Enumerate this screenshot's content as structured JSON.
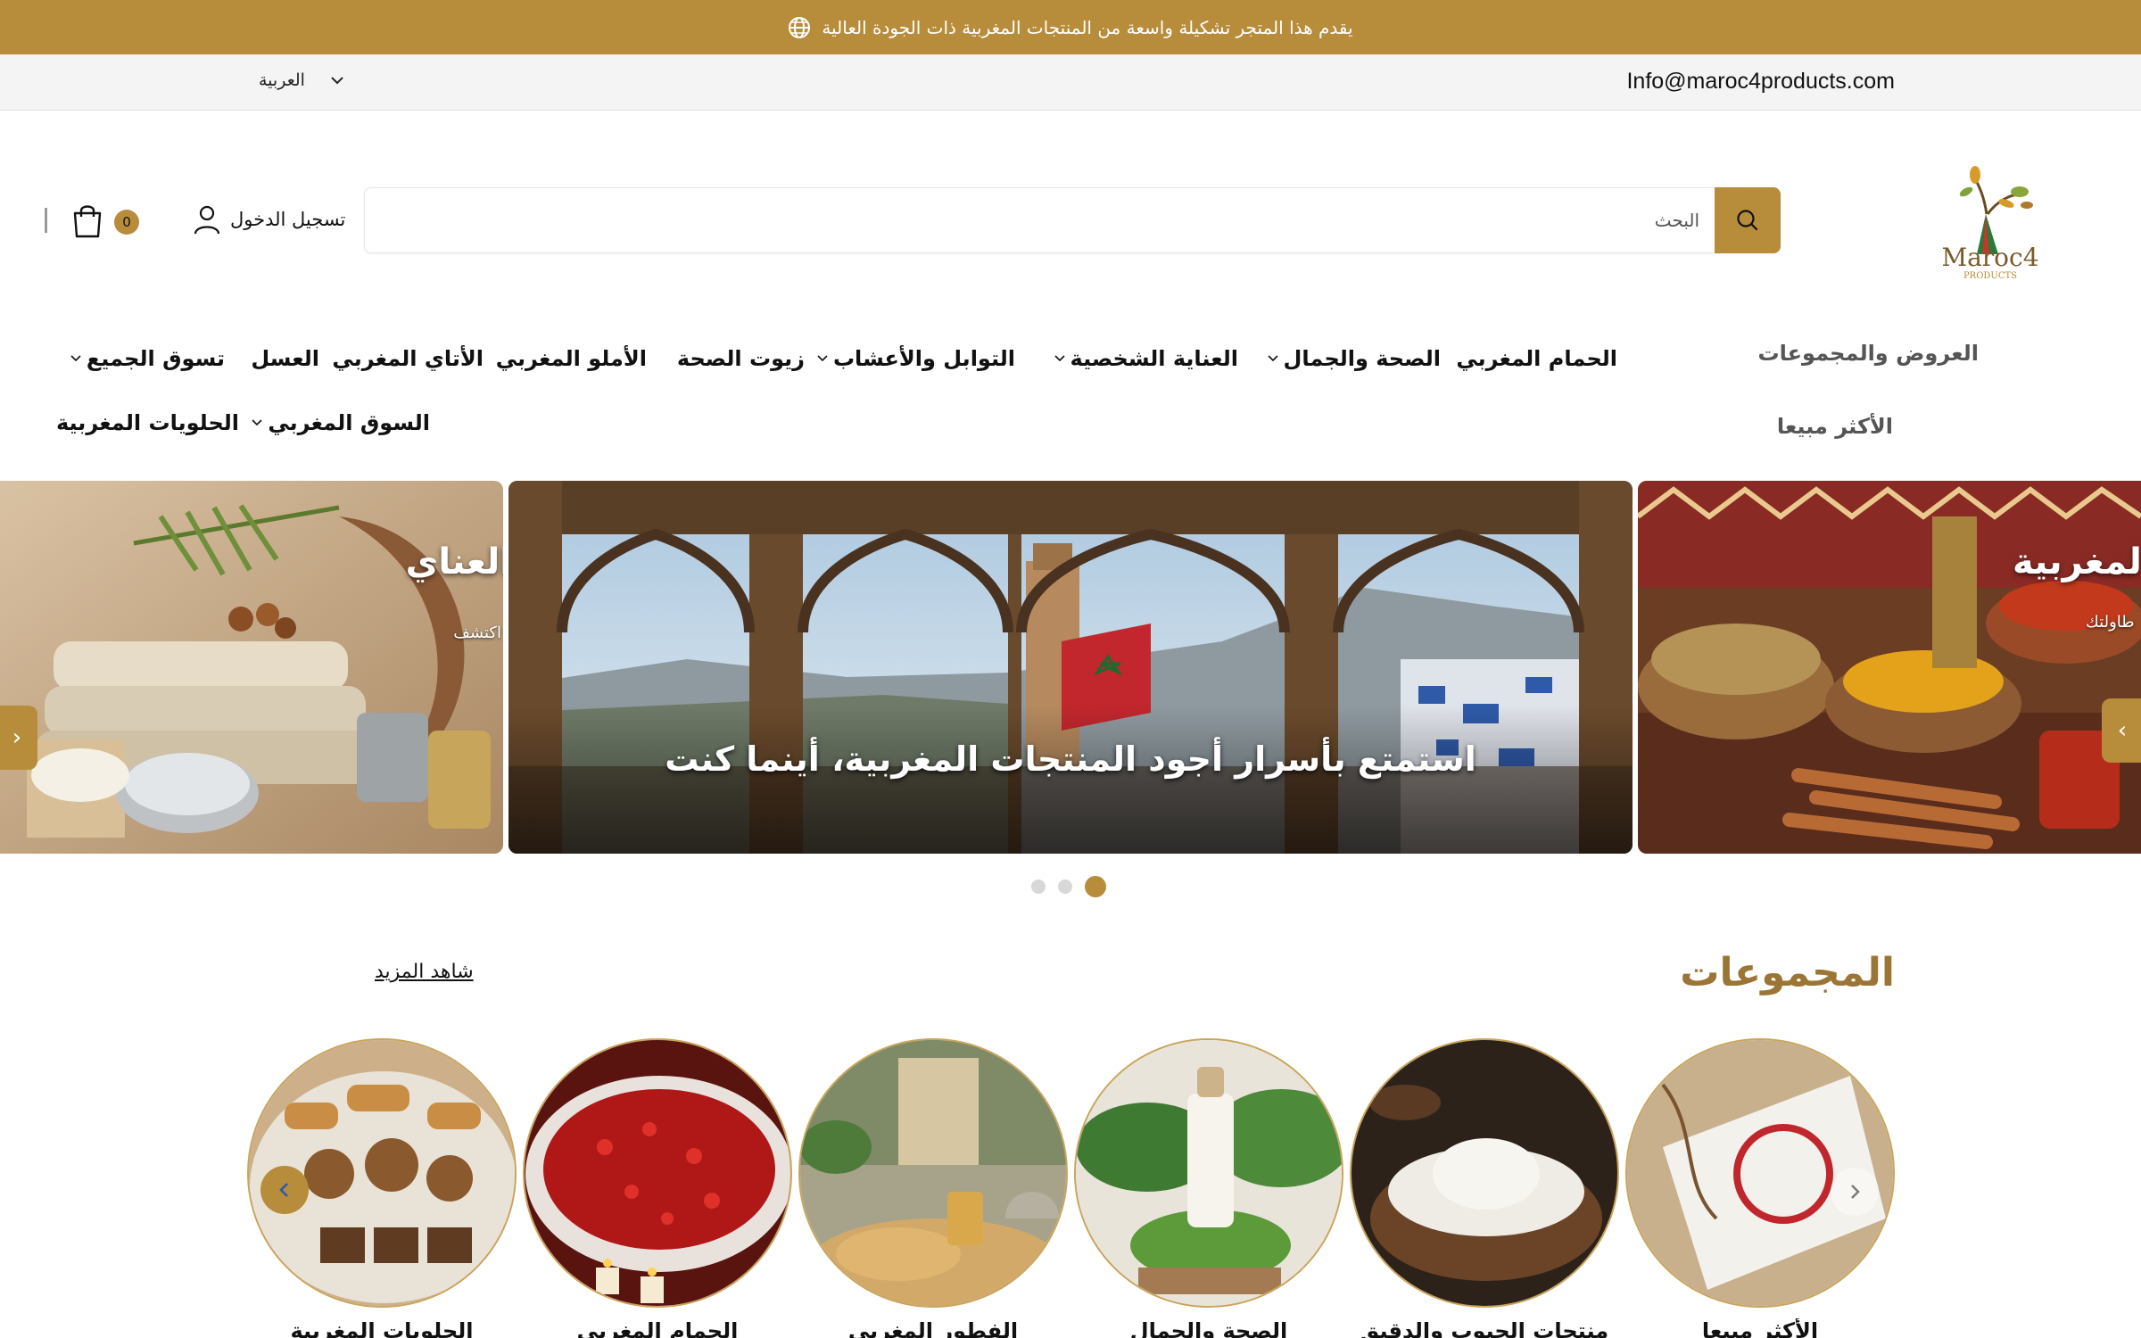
{
  "announcement": {
    "text": "يقدم هذا المتجر تشكيلة واسعة من المنتجات المغربية ذات الجودة العالية",
    "icon": "globe-icon"
  },
  "utility": {
    "language": "العربية",
    "email": "Info@maroc4products.com"
  },
  "brand": {
    "name": "Maroc4",
    "tagline": "PRODUCTS",
    "accent": "#b78c3a"
  },
  "search": {
    "placeholder": "البحث"
  },
  "account": {
    "login_label": "تسجيل الدخول",
    "cart_count": "0"
  },
  "nav": {
    "items": [
      {
        "label": "الحمام المغربي",
        "dropdown": false
      },
      {
        "label": "الصحة والجمال",
        "dropdown": true
      },
      {
        "label": "العناية الشخصية",
        "dropdown": true
      },
      {
        "label": "التوابل والأعشاب",
        "dropdown": true
      },
      {
        "label": "زيوت الصحة",
        "dropdown": false
      },
      {
        "label": "الأملو المغربي",
        "dropdown": false
      },
      {
        "label": "الأتاي المغربي",
        "dropdown": false
      },
      {
        "label": "العسل",
        "dropdown": false
      },
      {
        "label": "تسوق الجميع",
        "dropdown": true
      },
      {
        "label": "السوق المغربي",
        "dropdown": true
      },
      {
        "label": "الحلويات المغربية",
        "dropdown": false
      }
    ],
    "side": [
      "العروض والمجموعات",
      "الأكثر مبيعا"
    ]
  },
  "slider": {
    "main_caption": "استمتع بأسرار أجود المنتجات المغربية، أينما كنت",
    "left_title": "العناي",
    "left_sub": "اكتشف",
    "right_title": "المغربية",
    "right_sub": "طاولتك",
    "dots": 3,
    "active_dot": 3
  },
  "collections": {
    "title": "المجموعات",
    "see_more": "شاهد المزيد",
    "items": [
      {
        "label": "الأكثر مبيعا"
      },
      {
        "label": "منتجات الحبوب والدقيق"
      },
      {
        "label": "الصحة والجمال"
      },
      {
        "label": "الفطور المغربي"
      },
      {
        "label": "الحمام المغربي"
      },
      {
        "label": "الحلويات المغربية"
      }
    ]
  }
}
